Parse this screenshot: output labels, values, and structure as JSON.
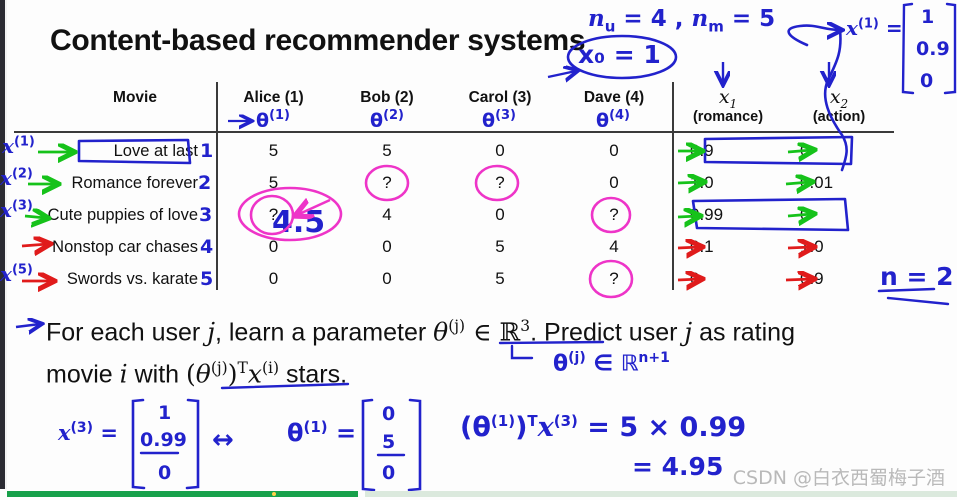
{
  "slide": {
    "title": "Content-based recommender systems"
  },
  "table": {
    "headers": [
      "Movie",
      "Alice (1)",
      "Bob (2)",
      "Carol (3)",
      "Dave (4)"
    ],
    "feature_headers": [
      {
        "symbol": "x",
        "sub": "1",
        "label": "(romance)"
      },
      {
        "symbol": "x",
        "sub": "2",
        "label": "(action)"
      }
    ],
    "rows": [
      {
        "movie": "Love at last",
        "index": "1",
        "ratings": [
          "5",
          "5",
          "0",
          "0"
        ],
        "features": [
          "0.9",
          "0"
        ]
      },
      {
        "movie": "Romance forever",
        "index": "2",
        "ratings": [
          "5",
          "?",
          "?",
          "0"
        ],
        "features": [
          "1.0",
          "0.01"
        ]
      },
      {
        "movie": "Cute puppies of love",
        "index": "3",
        "ratings": [
          "?",
          "4",
          "0",
          "?"
        ],
        "features": [
          "0.99",
          "0"
        ]
      },
      {
        "movie": "Nonstop car chases",
        "index": "4",
        "ratings": [
          "0",
          "0",
          "5",
          "4"
        ],
        "features": [
          "0.1",
          "1.0"
        ]
      },
      {
        "movie": "Swords vs. karate",
        "index": "5",
        "ratings": [
          "0",
          "0",
          "5",
          "?"
        ],
        "features": [
          "0",
          "0.9"
        ]
      }
    ]
  },
  "body_text": {
    "line1_a": "For each user ",
    "line1_j": "j",
    "line1_b": ", learn a parameter ",
    "line1_theta": "θ",
    "line1_theta_sup": "(j)",
    "line1_in": " ∈ ",
    "line1_R": "ℝ",
    "line1_R_sup": "3",
    "line1_c": ". Predict user ",
    "line1_j2": "j",
    "line1_d": " as rating",
    "line2_a": "movie ",
    "line2_i": "i",
    "line2_b": " with ",
    "line2_expr_open": "(",
    "line2_theta": "θ",
    "line2_theta_sup": "(j)",
    "line2_expr_close": ")",
    "line2_T": "T",
    "line2_x": "x",
    "line2_x_sup": "(i)",
    "line2_c": " stars."
  },
  "annotations": {
    "n_u": "n",
    "n_u_sub": "u",
    "n_u_eq": " = 4 ,  ",
    "n_m": "n",
    "n_m_sub": "m",
    "n_m_eq": " = 5",
    "x0_eq_1": "x₀ = 1",
    "x1_vec_label": "x",
    "x1_vec_sup": "(1)",
    "x1_vec_eq": " =",
    "x1_vec_values": [
      "1",
      "0.9",
      "0"
    ],
    "n_eq_2": "n = 2",
    "theta_user_labels": [
      "θ",
      "θ",
      "θ",
      "θ"
    ],
    "theta_user_sups": [
      "(1)",
      "(2)",
      "(3)",
      "(4)"
    ],
    "movie_x_labels": [
      {
        "sym": "x",
        "sup": "(1)"
      },
      {
        "sym": "x",
        "sup": "(2)"
      },
      {
        "sym": "x",
        "sup": "(3)"
      },
      {
        "sym": "x",
        "sup": "(5)"
      }
    ],
    "prediction_value": "4.5",
    "theta_in_R": "θ",
    "theta_in_R_sup": "(j)",
    "theta_in_R_rest": " ∈ ℝ",
    "theta_in_R_dim": "n+1",
    "bottom": {
      "x3_label": "x",
      "x3_sup": "(3)",
      "x3_eq": " =",
      "x3_values": [
        "1",
        "0.99",
        "0"
      ],
      "arrow": "↔",
      "theta1_label": "θ",
      "theta1_sup": "(1)",
      "theta1_eq": " =",
      "theta1_values": [
        "0",
        "5",
        "0"
      ],
      "calc_open": "(",
      "calc_theta": "θ",
      "calc_theta_sup": "(1)",
      "calc_close": ")",
      "calc_T": "T",
      "calc_x": "x",
      "calc_x_sup": "(3)",
      "calc_eq1": " = 5 × 0.99",
      "calc_eq2": "= 4.95"
    }
  },
  "watermark": {
    "text": "CSDN @白衣西蜀梅子酒"
  },
  "colors": {
    "ink_blue": "#2222cc",
    "ink_green": "#16c21a",
    "ink_red": "#e01b1b",
    "ink_pink": "#ee34c8",
    "progress": "#17a04a"
  }
}
